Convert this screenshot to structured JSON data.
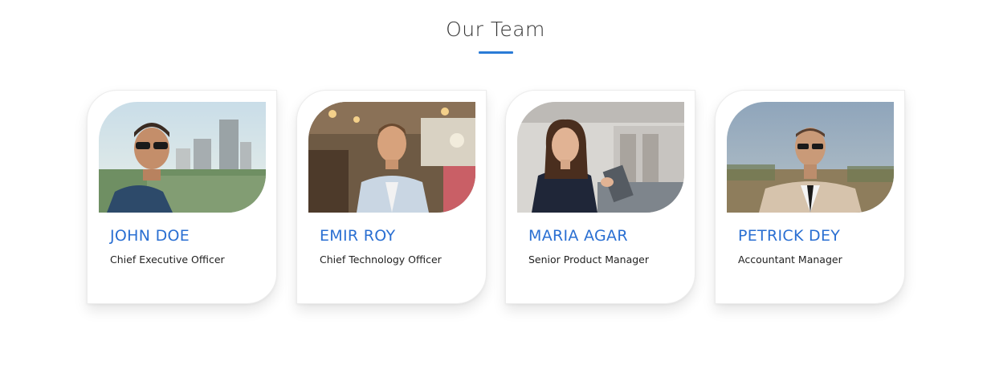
{
  "section": {
    "title": "Our Team",
    "accent_color": "#2a7bd6"
  },
  "members": [
    {
      "name": "JOHN DOE",
      "role": "Chief Executive Officer",
      "photo": "man-with-sunglasses-city-skyline-photo"
    },
    {
      "name": "EMIR ROY",
      "role": "Chief Technology Officer",
      "photo": "man-in-light-blazer-restaurant-photo"
    },
    {
      "name": "MARIA AGAR",
      "role": "Senior Product Manager",
      "photo": "woman-with-tablet-office-photo"
    },
    {
      "name": "PETRICK DEY",
      "role": "Accountant Manager",
      "photo": "man-in-suit-outdoor-photo"
    }
  ]
}
